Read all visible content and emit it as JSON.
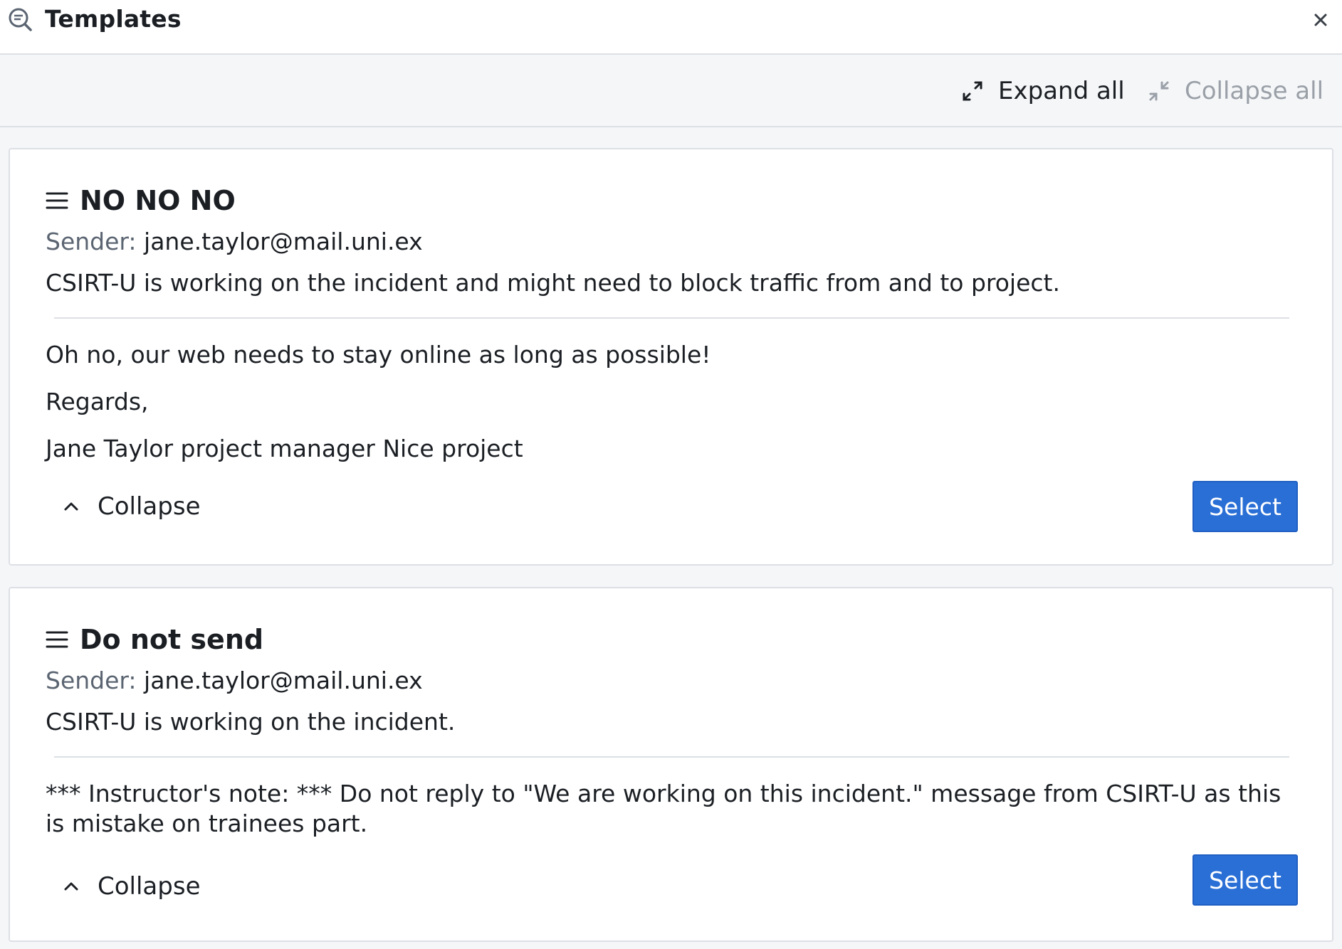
{
  "window": {
    "title": "Templates",
    "title_icon": "search-bubble-icon",
    "close_icon": "close-icon"
  },
  "toolbar": {
    "expand_all_label": "Expand all",
    "collapse_all_label": "Collapse all",
    "collapse_all_disabled": true
  },
  "templates": [
    {
      "title": "NO NO NO",
      "sender_label": "Sender:",
      "sender": "jane.taylor@mail.uni.ex",
      "summary": "CSIRT-U is working on the incident and might need to block traffic from and to project.",
      "body": [
        "Oh no, our web needs to stay online as long as possible!",
        "Regards,",
        "Jane Taylor project manager Nice project"
      ],
      "collapse_label": "Collapse",
      "select_label": "Select"
    },
    {
      "title": "Do not send",
      "sender_label": "Sender:",
      "sender": "jane.taylor@mail.uni.ex",
      "summary": "CSIRT-U is working on the incident.",
      "body": [
        "*** Instructor's note: *** Do not reply to \"We are working on this incident.\" message from CSIRT-U as this is mistake on trainees part."
      ],
      "collapse_label": "Collapse",
      "select_label": "Select"
    }
  ],
  "colors": {
    "accent": "#2a6fd6",
    "muted": "#9aa0a8",
    "label": "#5b6572"
  }
}
